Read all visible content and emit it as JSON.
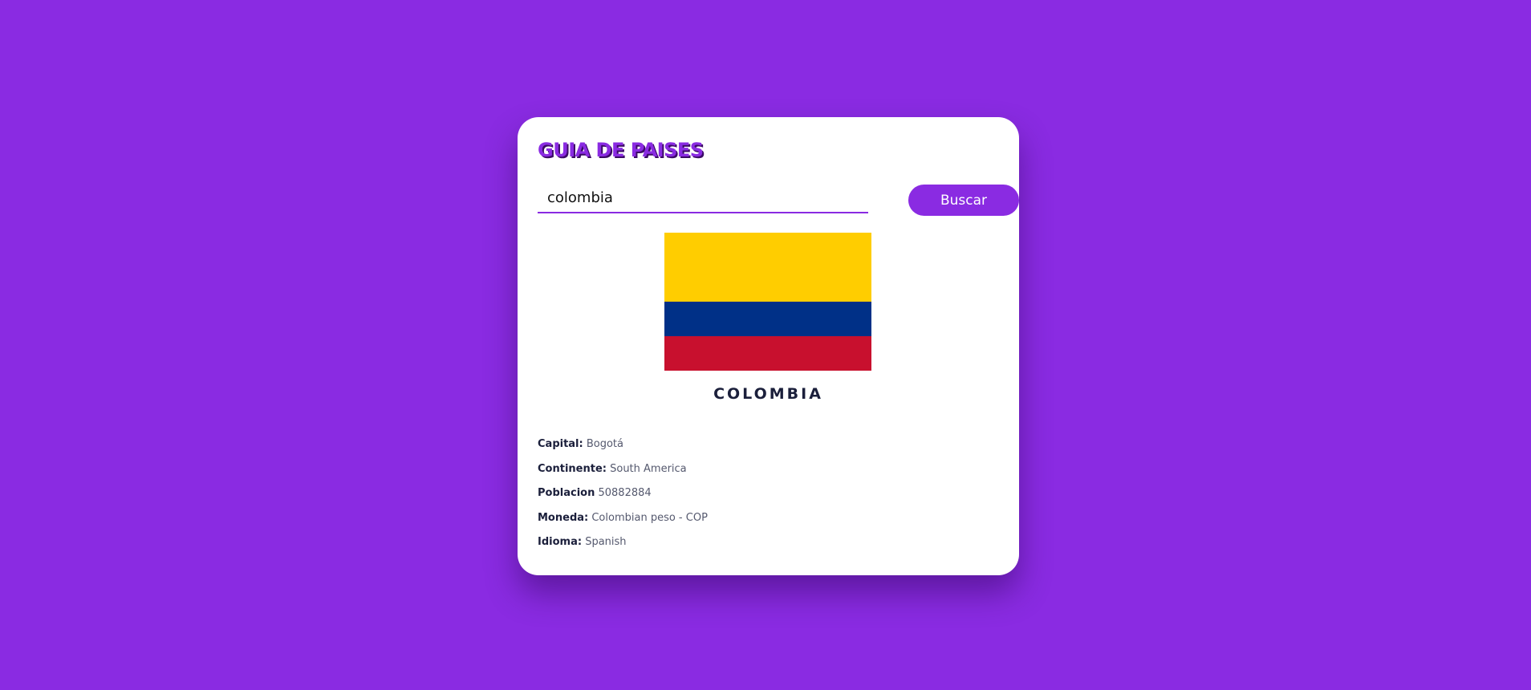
{
  "app": {
    "title": "GUIA DE PAISES"
  },
  "colors": {
    "background": "#8a2be2",
    "accent": "#8a2be2",
    "card": "#ffffff",
    "text_dark": "#1b1f3b",
    "text_muted": "#55596e"
  },
  "search": {
    "value": "colombia",
    "button_label": "Buscar"
  },
  "country": {
    "name": "COLOMBIA",
    "flag": {
      "stripes": [
        "#ffcd00",
        "#003087",
        "#c8102e"
      ]
    },
    "details": [
      {
        "label": "Capital:",
        "value": "Bogotá"
      },
      {
        "label": "Continente:",
        "value": "South America"
      },
      {
        "label": "Poblacion",
        "value": "50882884"
      },
      {
        "label": "Moneda:",
        "value": "Colombian peso - COP"
      },
      {
        "label": "Idioma:",
        "value": "Spanish"
      }
    ]
  }
}
